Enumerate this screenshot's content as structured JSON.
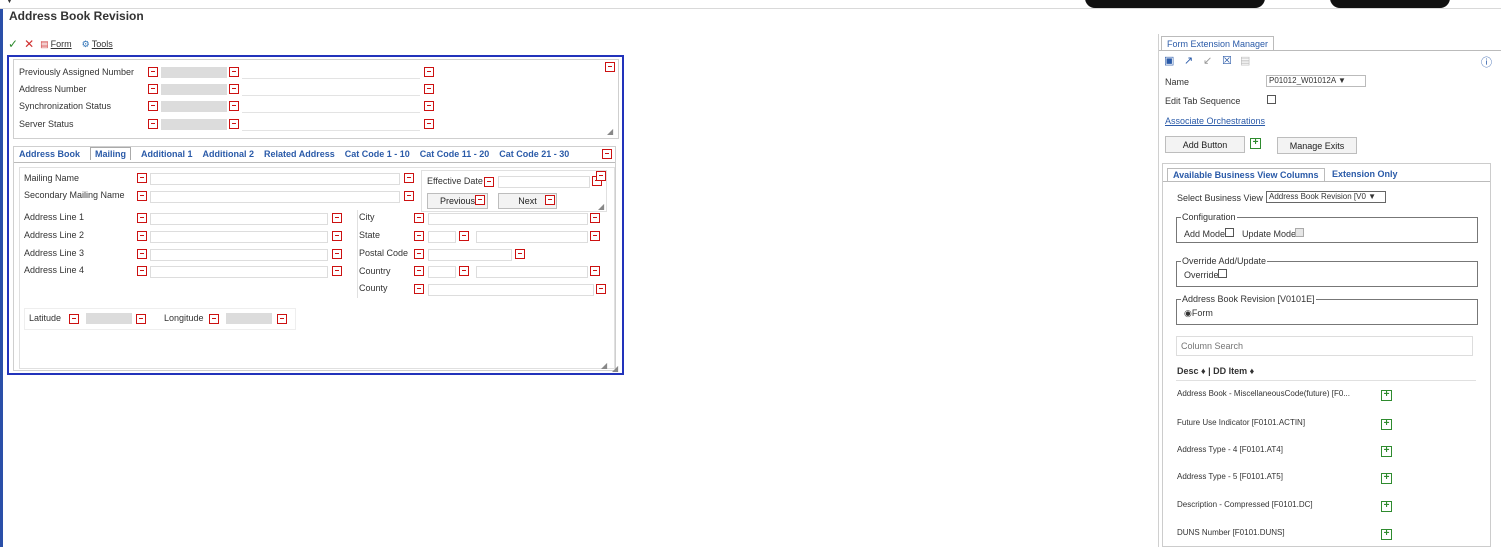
{
  "window": {
    "title": "Address Book Revision"
  },
  "toolbar": {
    "form_label": "Form",
    "tools_label": "Tools"
  },
  "header_section": {
    "rows": [
      {
        "label": "Previously Assigned Number"
      },
      {
        "label": "Address Number"
      },
      {
        "label": "Synchronization Status"
      },
      {
        "label": "Server Status"
      }
    ]
  },
  "tabs": [
    {
      "label": "Address Book"
    },
    {
      "label": "Mailing"
    },
    {
      "label": "Additional 1"
    },
    {
      "label": "Additional 2"
    },
    {
      "label": "Related Address"
    },
    {
      "label": "Cat Code 1 - 10"
    },
    {
      "label": "Cat Code 11 - 20"
    },
    {
      "label": "Cat Code 21 - 30"
    }
  ],
  "mailing": {
    "mailing_name": "Mailing Name",
    "secondary_mailing_name": "Secondary Mailing Name",
    "effective_date": "Effective Date",
    "previous_button": "Previous",
    "next_button": "Next",
    "address_lines": [
      "Address Line 1",
      "Address Line 2",
      "Address Line 3",
      "Address Line 4"
    ],
    "city": "City",
    "state": "State",
    "postal_code": "Postal Code",
    "country": "Country",
    "county": "County",
    "latitude": "Latitude",
    "longitude": "Longitude"
  },
  "extension_manager": {
    "tab_label": "Form Extension Manager",
    "name_label": "Name",
    "name_value": "P01012_W01012A",
    "edit_tab_sequence": "Edit Tab Sequence",
    "associate_orchestrations": "Associate Orchestrations",
    "add_button": "Add Button",
    "manage_exits": "Manage Exits",
    "subtabs": [
      "Available Business View Columns",
      "Extension Only"
    ],
    "select_bv_label": "Select Business View :",
    "select_bv_value": "Address Book Revision [V0",
    "configuration_legend": "Configuration",
    "add_mode": "Add Mode",
    "update_mode": "Update Mode",
    "override_legend": "Override Add/Update",
    "override": "Override",
    "bv_legend": "Address Book Revision [V0101E]",
    "form_radio": "Form",
    "column_search_placeholder": "Column Search",
    "col_header": "Desc ♦  | DD Item ♦",
    "columns": [
      "Address Book - MiscellaneousCode(future) [F0...",
      "Future Use Indicator [F0101.ACTIN]",
      "Address Type - 4 [F0101.AT4]",
      "Address Type - 5 [F0101.AT5]",
      "Description - Compressed [F0101.DC]",
      "DUNS Number [F0101.DUNS]"
    ]
  }
}
